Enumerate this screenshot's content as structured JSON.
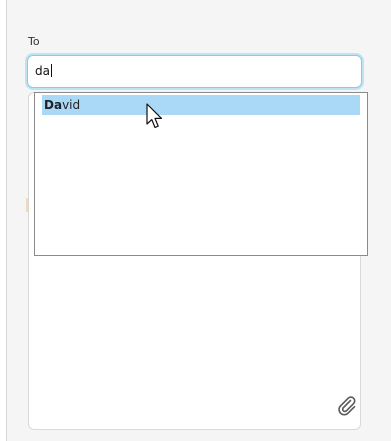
{
  "recipient": {
    "label": "To",
    "value": "da"
  },
  "autocomplete": {
    "items": [
      {
        "match": "Da",
        "rest": "vid"
      }
    ]
  },
  "icons": {
    "attach": "paperclip-icon",
    "pointer": "mouse-cursor-icon"
  },
  "colors": {
    "input_focus": "#8ec9e8",
    "selection": "#aad8f7"
  }
}
